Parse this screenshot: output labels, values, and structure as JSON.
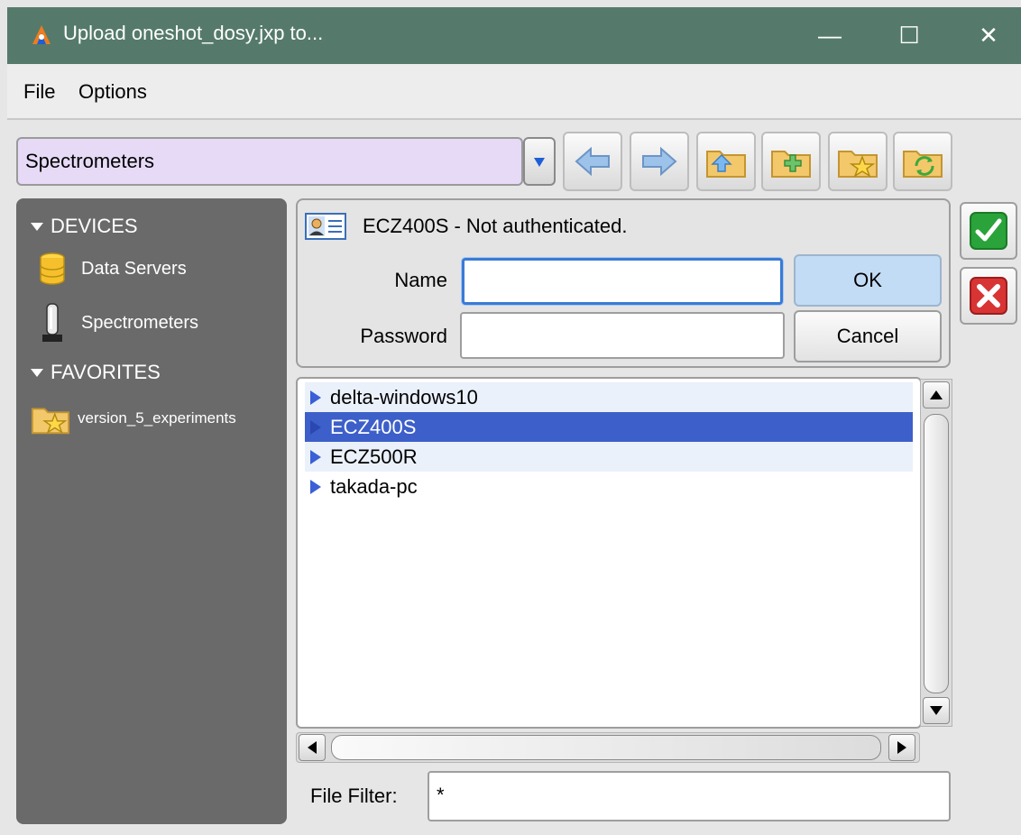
{
  "window": {
    "title": "Upload oneshot_dosy.jxp to...",
    "controls": {
      "minimize": "—",
      "maximize": "☐",
      "close": "✕"
    }
  },
  "menu": {
    "file": "File",
    "options": "Options"
  },
  "location": {
    "value": "Spectrometers"
  },
  "toolbar": {
    "icons": [
      "back-arrow-icon",
      "forward-arrow-icon",
      "folder-up-icon",
      "new-folder-icon",
      "favorite-folder-icon",
      "refresh-folder-icon"
    ]
  },
  "sidebar": {
    "devices_header": "DEVICES",
    "favorites_header": "FAVORITES",
    "devices": [
      {
        "label": "Data Servers",
        "icon": "database-icon"
      },
      {
        "label": "Spectrometers",
        "icon": "spectrometer-icon"
      }
    ],
    "favorites": [
      {
        "label": "version_5_experiments",
        "icon": "favorite-folder-icon"
      }
    ]
  },
  "auth": {
    "status": "ECZ400S - Not authenticated.",
    "name_label": "Name",
    "name_value": "",
    "password_label": "Password",
    "password_value": "",
    "ok": "OK",
    "cancel": "Cancel"
  },
  "files": [
    {
      "name": "delta-windows10",
      "selected": false
    },
    {
      "name": "ECZ400S",
      "selected": true
    },
    {
      "name": "ECZ500R",
      "selected": false
    },
    {
      "name": "takada-pc",
      "selected": false
    }
  ],
  "filter": {
    "label": "File Filter:",
    "value": "*"
  },
  "colors": {
    "titlebar": "#557a6b",
    "location_bg": "#e6daf6",
    "selection": "#3d5fc9",
    "sidebar": "#6a6a6a",
    "confirm": "#2aa33a",
    "cancel": "#d83434"
  }
}
